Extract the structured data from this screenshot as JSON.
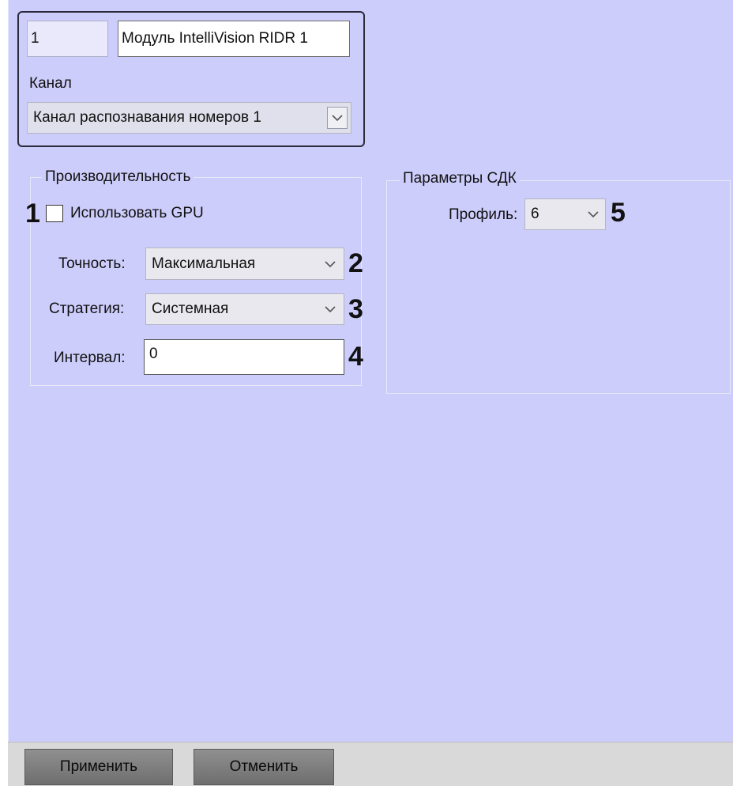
{
  "header": {
    "id_value": "1",
    "name_value": "Модуль IntelliVision RIDR 1",
    "channel_label": "Канал",
    "channel_value": "Канал распознавания номеров 1"
  },
  "performance": {
    "title": "Производительность",
    "use_gpu_label": "Использовать GPU",
    "use_gpu_checked": false,
    "accuracy_label": "Точность:",
    "accuracy_value": "Максимальная",
    "strategy_label": "Стратегия:",
    "strategy_value": "Системная",
    "interval_label": "Интервал:",
    "interval_value": "0"
  },
  "sdk": {
    "title": "Параметры СДК",
    "profile_label": "Профиль:",
    "profile_value": "6"
  },
  "markers": [
    "1",
    "2",
    "3",
    "4",
    "5"
  ],
  "buttons": {
    "apply": "Применить",
    "cancel": "Отменить"
  },
  "colors": {
    "panel_background": "#cdcdfc",
    "footer_background": "#d9d9d9",
    "button_background": "#7f7f7f"
  },
  "icons": {
    "dropdown": "chevron-down-icon"
  }
}
